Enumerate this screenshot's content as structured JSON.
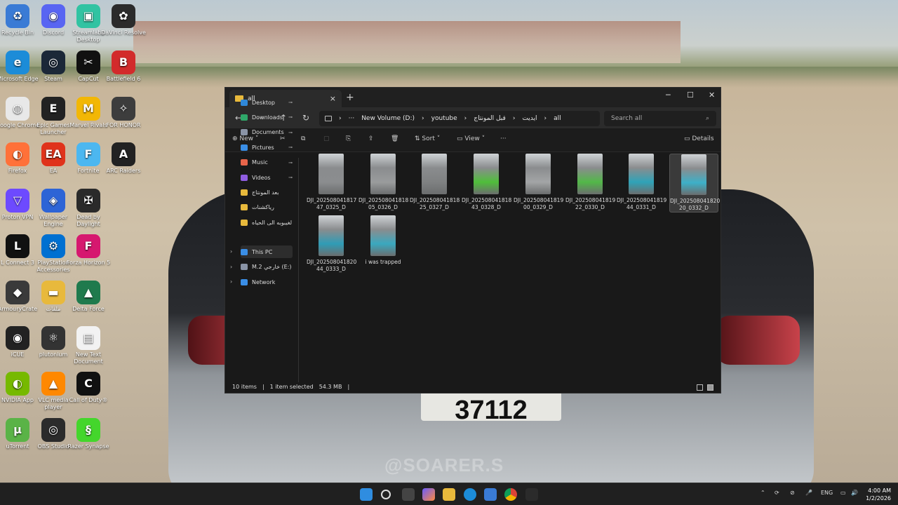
{
  "desktop": {
    "icons": [
      {
        "label": "Recycle Bin",
        "color": "#3a7bd5",
        "glyph": "♻"
      },
      {
        "label": "Discord",
        "color": "#5865f2",
        "glyph": "◉"
      },
      {
        "label": "Streamlabs Desktop",
        "color": "#31c3a2",
        "glyph": "▣"
      },
      {
        "label": "DaVinci Resolve",
        "color": "#2b2b2b",
        "glyph": "✿"
      },
      {
        "label": "Microsoft Edge",
        "color": "#1c8cd8",
        "glyph": "e"
      },
      {
        "label": "Steam",
        "color": "#1b2838",
        "glyph": "◎"
      },
      {
        "label": "CapCut",
        "color": "#111111",
        "glyph": "✂"
      },
      {
        "label": "Battlefield 6",
        "color": "#d22b2b",
        "glyph": "B"
      },
      {
        "label": "Google Chrome",
        "color": "#e8e8e8",
        "glyph": "◍"
      },
      {
        "label": "Epic Games Launcher",
        "color": "#222222",
        "glyph": "E"
      },
      {
        "label": "Marvel Rivals",
        "color": "#f2b705",
        "glyph": "M"
      },
      {
        "label": "FOR HONOR",
        "color": "#3d3d3d",
        "glyph": "✧"
      },
      {
        "label": "Firefox",
        "color": "#ff7139",
        "glyph": "◐"
      },
      {
        "label": "EA",
        "color": "#e0331b",
        "glyph": "EA"
      },
      {
        "label": "Fortnite",
        "color": "#4cb7f0",
        "glyph": "F"
      },
      {
        "label": "ARC Raiders",
        "color": "#222222",
        "glyph": "A"
      },
      {
        "label": "Proton VPN",
        "color": "#6d4aff",
        "glyph": "▽"
      },
      {
        "label": "Wallpaper Engine",
        "color": "#2d64d6",
        "glyph": "◈"
      },
      {
        "label": "Dead by Daylight",
        "color": "#2a2a2a",
        "glyph": "✠"
      },
      {
        "label": "L Connect 3",
        "color": "#111111",
        "glyph": "L"
      },
      {
        "label": "PlayStation Accessories",
        "color": "#0070d1",
        "glyph": "⚙"
      },
      {
        "label": "Forza Horizon 5",
        "color": "#d6186f",
        "glyph": "F"
      },
      {
        "label": "ArmouryCrate",
        "color": "#3a3a3a",
        "glyph": "◆"
      },
      {
        "label": "ملفات",
        "color": "#e8b93c",
        "glyph": "▬"
      },
      {
        "label": "Delta Force",
        "color": "#1f7a4d",
        "glyph": "▲"
      },
      {
        "label": "iCUE",
        "color": "#222222",
        "glyph": "◉"
      },
      {
        "label": "plutonium",
        "color": "#333333",
        "glyph": "⚛"
      },
      {
        "label": "New Text Document",
        "color": "#f2f2f2",
        "glyph": "▤"
      },
      {
        "label": "NVIDIA App",
        "color": "#76b900",
        "glyph": "◐"
      },
      {
        "label": "VLC media player",
        "color": "#ff8800",
        "glyph": "▲"
      },
      {
        "label": "Call of Duty®",
        "color": "#111111",
        "glyph": "C"
      },
      {
        "label": "uTorrent",
        "color": "#5ab347",
        "glyph": "μ"
      },
      {
        "label": "OBS Studio",
        "color": "#2b2b2b",
        "glyph": "◎"
      },
      {
        "label": "Razer Synapse",
        "color": "#44d62c",
        "glyph": "§"
      }
    ],
    "watermark": "@SOARER.S",
    "plate": "37112"
  },
  "explorer": {
    "tab_title": "all",
    "tab_close": "×",
    "new_tab": "+",
    "window_controls": {
      "minimize": "─",
      "maximize": "☐",
      "close": "✕"
    },
    "nav": {
      "back": "←",
      "forward": "→",
      "up": "↑",
      "refresh": "↻"
    },
    "breadcrumbs": [
      "New Volume (D:)",
      "youtube",
      "قبل المونتاج",
      "ايديت",
      "all"
    ],
    "breadcrumb_sep": "›",
    "breadcrumb_more": "···",
    "search_placeholder": "Search all",
    "toolbar": {
      "new_label": "New",
      "sort_label": "Sort",
      "view_label": "View",
      "more": "···",
      "details_label": "Details"
    },
    "sidebar": {
      "quick": [
        {
          "label": "Desktop",
          "color": "#2f88d8",
          "pinned": true
        },
        {
          "label": "Downloads",
          "color": "#2fa86a",
          "pinned": true
        },
        {
          "label": "Documents",
          "color": "#8a94a6",
          "pinned": true
        },
        {
          "label": "Pictures",
          "color": "#3a8ee6",
          "pinned": true
        },
        {
          "label": "Music",
          "color": "#e8654a",
          "pinned": true
        },
        {
          "label": "Videos",
          "color": "#8f5de0",
          "pinned": true
        },
        {
          "label": "بعد المونتاج",
          "color": "#e8b93c",
          "pinned": false
        },
        {
          "label": "رياكشنات",
          "color": "#e8b93c",
          "pinned": false
        },
        {
          "label": "لغيبوبه الى الحياه",
          "color": "#e8b93c",
          "pinned": false
        }
      ],
      "drives": [
        {
          "label": "This PC",
          "color": "#3a8ee6"
        },
        {
          "label": "M.2 خارجي (E:)",
          "color": "#8a94a6"
        },
        {
          "label": "Network",
          "color": "#3a8ee6"
        }
      ],
      "pin_glyph": "📌",
      "chev": "›"
    },
    "files": [
      {
        "line1": "DJI_202508041817",
        "line2": "47_0325_D",
        "thumb": "#8b8d8f",
        "selected": false
      },
      {
        "line1": "DJI_202508041818",
        "line2": "05_0326_D",
        "thumb": "#9a9c9d",
        "selected": false
      },
      {
        "line1": "DJI_202508041818",
        "line2": "25_0327_D",
        "thumb": "#7f8182",
        "selected": false
      },
      {
        "line1": "DJI_202508041818",
        "line2": "43_0328_D",
        "thumb": "#4fbf3a",
        "selected": false
      },
      {
        "line1": "DJI_202508041819",
        "line2": "00_0329_D",
        "thumb": "#a3a5a6",
        "selected": false
      },
      {
        "line1": "DJI_202508041819",
        "line2": "22_0330_D",
        "thumb": "#52b848",
        "selected": false
      },
      {
        "line1": "DJI_202508041819",
        "line2": "44_0331_D",
        "thumb": "#2fa3b8",
        "selected": false
      },
      {
        "line1": "DJI_202508041820",
        "line2": "20_0332_D",
        "thumb": "#3db0c8",
        "selected": true
      },
      {
        "line1": "DJI_202508041820",
        "line2": "44_0333_D",
        "thumb": "#2f9cb6",
        "selected": false
      },
      {
        "line1": "i was trapped",
        "line2": "",
        "thumb": "#3aa8bf",
        "selected": false
      }
    ],
    "status": {
      "count": "10 items",
      "selection": "1 item selected",
      "size": "54.3 MB"
    }
  },
  "taskbar": {
    "language": "ENG",
    "time": "4:00 AM",
    "date": "1/2/2026",
    "tray_arrow": "⌃"
  }
}
